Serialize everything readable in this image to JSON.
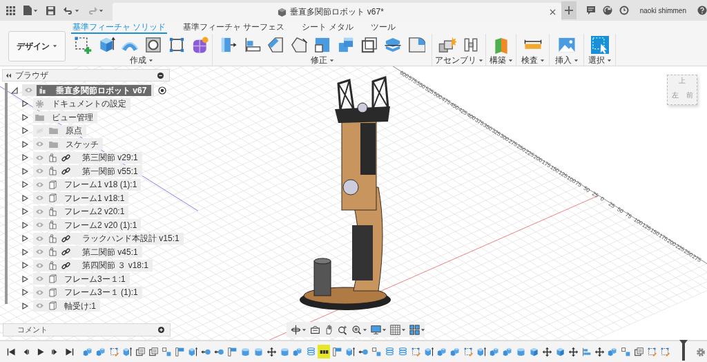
{
  "title_bar": {
    "document_title": "垂直多関節ロボット v67*",
    "user_name": "naoki shimmen"
  },
  "workspace": {
    "label": "デザイン"
  },
  "toolbar_tabs": [
    {
      "label": "基準フィーチャ ソリッド",
      "selected": true
    },
    {
      "label": "基準フィーチャ サーフェス",
      "selected": false
    },
    {
      "label": "シート メタル",
      "selected": false
    },
    {
      "label": "ツール",
      "selected": false
    }
  ],
  "tool_groups": [
    {
      "label": "作成"
    },
    {
      "label": "修正"
    },
    {
      "label": "アセンブリ"
    },
    {
      "label": "構築"
    },
    {
      "label": "検査"
    },
    {
      "label": "挿入"
    },
    {
      "label": "選択"
    }
  ],
  "browser": {
    "title": "ブラウザ",
    "root": {
      "label": "垂直多関節ロボット v67",
      "kind": "component",
      "active": true,
      "expanded": true,
      "visible": true,
      "linked": false,
      "children": [
        {
          "label": "ドキュメントの設定",
          "kind": "settings",
          "expanded": false,
          "linked": false
        },
        {
          "label": "ビュー管理",
          "kind": "folder",
          "expanded": false,
          "linked": false
        },
        {
          "label": "原点",
          "kind": "folder",
          "visible": false,
          "expanded": false,
          "linked": false
        },
        {
          "label": "スケッチ",
          "kind": "folder",
          "visible": true,
          "expanded": false,
          "linked": false
        },
        {
          "label": "第三関節 v29:1",
          "kind": "component",
          "visible": true,
          "expanded": false,
          "linked": true
        },
        {
          "label": "第一関節 v55:1",
          "kind": "component",
          "visible": true,
          "expanded": false,
          "linked": true
        },
        {
          "label": "フレーム1 v18 (1):1",
          "kind": "body",
          "visible": true,
          "expanded": false,
          "linked": false
        },
        {
          "label": "フレーム1 v18:1",
          "kind": "body",
          "visible": true,
          "expanded": false,
          "linked": false
        },
        {
          "label": "フレーム2 v20:1",
          "kind": "component",
          "visible": true,
          "expanded": false,
          "linked": false
        },
        {
          "label": "フレーム2 v20 (1):1",
          "kind": "component",
          "visible": true,
          "expanded": false,
          "linked": false
        },
        {
          "label": "ラックハンド本設計 v15:1",
          "kind": "component",
          "visible": true,
          "expanded": false,
          "linked": true
        },
        {
          "label": "第二関節 v45:1",
          "kind": "component",
          "visible": true,
          "expanded": false,
          "linked": true
        },
        {
          "label": "第四関節 ３ v18:1",
          "kind": "component",
          "visible": true,
          "expanded": false,
          "linked": true
        },
        {
          "label": "フレーム3ー１:1",
          "kind": "body",
          "visible": true,
          "expanded": false,
          "linked": false
        },
        {
          "label": "フレーム3ー１ (1):1",
          "kind": "body",
          "visible": true,
          "expanded": false,
          "linked": false
        },
        {
          "label": "軸受け:1",
          "kind": "body",
          "visible": true,
          "expanded": false,
          "linked": false
        }
      ]
    }
  },
  "comments": {
    "title": "コメント"
  },
  "view_cube": {
    "faces": [
      "上",
      "左",
      "前"
    ]
  },
  "grid_ruler": {
    "labels": [
      "600",
      "575",
      "550",
      "525",
      "500",
      "475",
      "450",
      "425",
      "400",
      "375",
      "350",
      "325",
      "300",
      "275",
      "250",
      "225",
      "200",
      "175",
      "150",
      "125",
      "100",
      "75",
      "50",
      "25",
      "0",
      "25",
      "50",
      "75",
      "100",
      "125",
      "150",
      "175",
      "200",
      "225",
      "250",
      "275"
    ]
  },
  "timeline": {
    "features": [
      {
        "kind": "extrude",
        "selected": false
      },
      {
        "kind": "extrude",
        "selected": false
      },
      {
        "kind": "sketch",
        "selected": false
      },
      {
        "kind": "presspull",
        "selected": false
      },
      {
        "kind": "shell",
        "selected": false
      },
      {
        "kind": "shell",
        "selected": false
      },
      {
        "kind": "split",
        "selected": false
      },
      {
        "kind": "corner",
        "selected": false
      },
      {
        "kind": "presspull",
        "selected": false
      },
      {
        "kind": "joint",
        "selected": false
      },
      {
        "kind": "joint",
        "selected": false
      },
      {
        "kind": "corner",
        "selected": false
      },
      {
        "kind": "cylinder",
        "selected": false
      },
      {
        "kind": "cylinder",
        "selected": false
      },
      {
        "kind": "move",
        "selected": false
      },
      {
        "kind": "cylinder",
        "selected": false
      },
      {
        "kind": "extrude",
        "selected": false
      },
      {
        "kind": "coil",
        "selected": false
      },
      {
        "kind": "pattern",
        "selected": true
      },
      {
        "kind": "corner",
        "selected": false
      },
      {
        "kind": "presspull",
        "selected": false
      },
      {
        "kind": "joint",
        "selected": false
      },
      {
        "kind": "split",
        "selected": false
      },
      {
        "kind": "coil",
        "selected": false
      },
      {
        "kind": "coil",
        "selected": false
      },
      {
        "kind": "sketch",
        "selected": false
      },
      {
        "kind": "presspull",
        "selected": false
      },
      {
        "kind": "extrude",
        "selected": false
      },
      {
        "kind": "extrude",
        "selected": false
      },
      {
        "kind": "sketch",
        "selected": false
      },
      {
        "kind": "presspull",
        "selected": false
      },
      {
        "kind": "extrude",
        "selected": false
      },
      {
        "kind": "extrude",
        "selected": false
      },
      {
        "kind": "cylinder",
        "selected": false
      },
      {
        "kind": "box",
        "selected": false
      },
      {
        "kind": "move",
        "selected": false
      },
      {
        "kind": "box",
        "selected": false
      },
      {
        "kind": "move",
        "selected": false
      },
      {
        "kind": "align",
        "selected": false
      },
      {
        "kind": "move",
        "selected": false
      },
      {
        "kind": "extrude",
        "selected": false
      },
      {
        "kind": "split",
        "selected": false
      },
      {
        "kind": "shell",
        "selected": false
      },
      {
        "kind": "sketch",
        "selected": false
      },
      {
        "kind": "sketch",
        "selected": false
      }
    ]
  }
}
